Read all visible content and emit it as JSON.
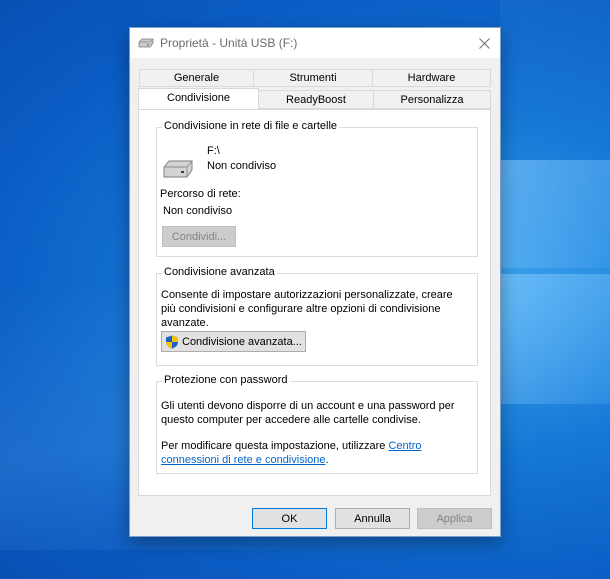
{
  "window": {
    "title": "Proprietà - Unità USB (F:)"
  },
  "tabs_back": [
    "Generale",
    "Strumenti",
    "Hardware"
  ],
  "tabs_front": [
    "Condivisione",
    "ReadyBoost",
    "Personalizza"
  ],
  "active_tab": "Condivisione",
  "network_sharing": {
    "label": "Condivisione in rete di file e cartelle",
    "drive_path": "F:\\",
    "drive_status": "Non condiviso",
    "network_path_label": "Percorso di rete:",
    "network_path_value": "Non condiviso",
    "share_button": "Condividi..."
  },
  "advanced_sharing": {
    "label": "Condivisione avanzata",
    "description": "Consente di impostare autorizzazioni personalizzate, creare più condivisioni e configurare altre opzioni di condivisione avanzate.",
    "button": "Condivisione avanzata..."
  },
  "password_protection": {
    "label": "Protezione con password",
    "description": "Gli utenti devono disporre di un account e una password per questo computer per accedere alle cartelle condivise.",
    "change_text": "Per modificare questa impostazione, utilizzare ",
    "link_text": "Centro connessioni di rete e condivisione",
    "end_text": "."
  },
  "buttons": {
    "ok": "OK",
    "cancel": "Annulla",
    "apply": "Applica"
  }
}
